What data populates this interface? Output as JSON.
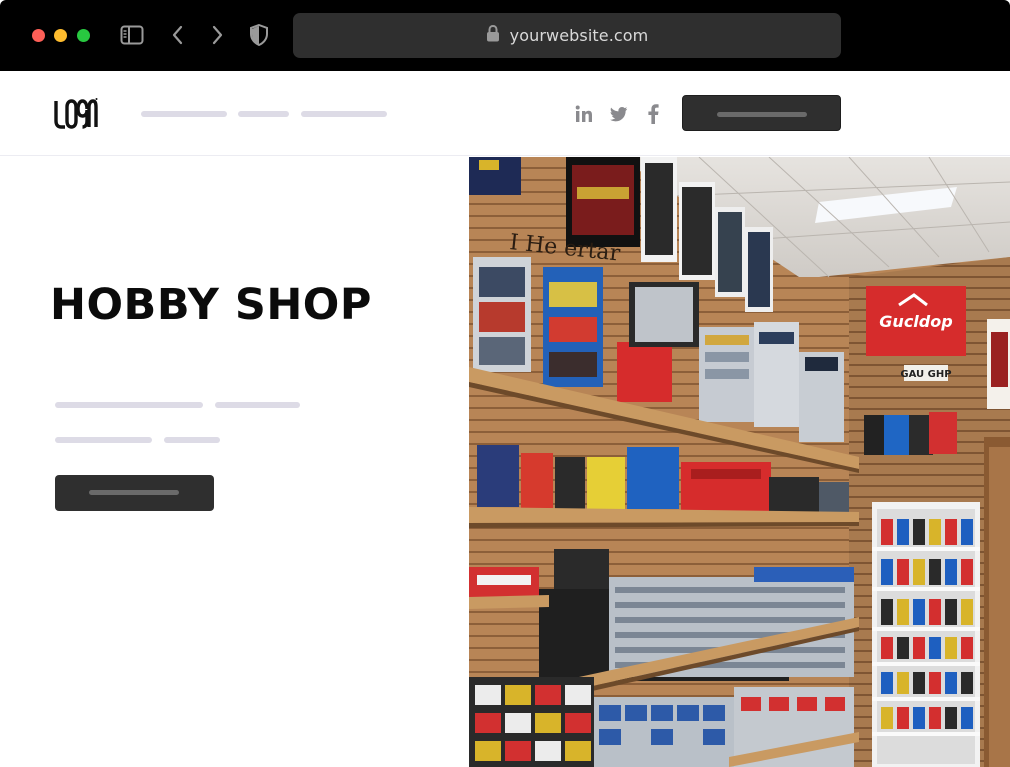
{
  "browser": {
    "url": "yourwebsite.com",
    "icons": {
      "sidebar": "sidebar-icon",
      "back": "chevron-left-icon",
      "forward": "chevron-right-icon",
      "shield": "shield-icon",
      "lock": "lock-icon"
    },
    "colors": {
      "close": "#fe5f57",
      "minimize": "#febc2e",
      "maximize": "#28c840"
    }
  },
  "header": {
    "logo_text": "LOGO",
    "social": [
      "linkedin-icon",
      "twitter-icon",
      "facebook-icon"
    ],
    "accent": "#2f2f2f"
  },
  "hero": {
    "title": "HOBBY SHOP",
    "image_signs": {
      "main_sign": "Gucldop",
      "small_sign": "GAU GHP",
      "wall_text": "I He ertar"
    }
  }
}
